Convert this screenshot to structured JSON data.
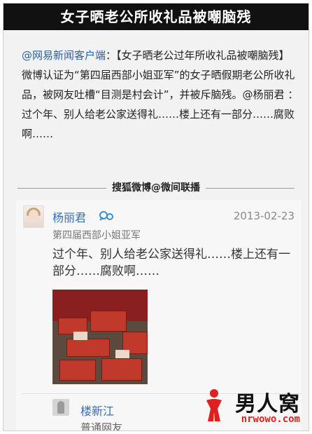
{
  "header": {
    "title": "女子晒老公所收礼品被嘲脑残"
  },
  "news": {
    "source": "@网易新闻客户端",
    "body": "：【女子晒老公过年所收礼品被嘲脑残】微博认证为“第四届西部小姐亚军”的女子晒假期老公所收礼品，被网友吐槽“目测是村会计”，并被斥脑残。@杨丽君 ： 过个年、别人给老公家送得礼……楼上还有一部分……腐败啊……"
  },
  "divider": {
    "label": "搜狐微博@微间联播"
  },
  "post": {
    "username": "杨丽君",
    "vip_icon": "verified-badge-icon",
    "date": "2013-02-23",
    "user_title": "第四届西部小姐亚军",
    "text": "过个年、别人给老公家送得礼……楼上还有一部分……腐败啊……"
  },
  "second_user": {
    "name": "楼新江",
    "title": "普通网友"
  },
  "watermark": {
    "brand": "男人窝",
    "domain": "nrwowo.com"
  },
  "colors": {
    "title_bar": "#111111",
    "link_blue": "#3a6fb0",
    "watermark_red": "#e02020"
  }
}
